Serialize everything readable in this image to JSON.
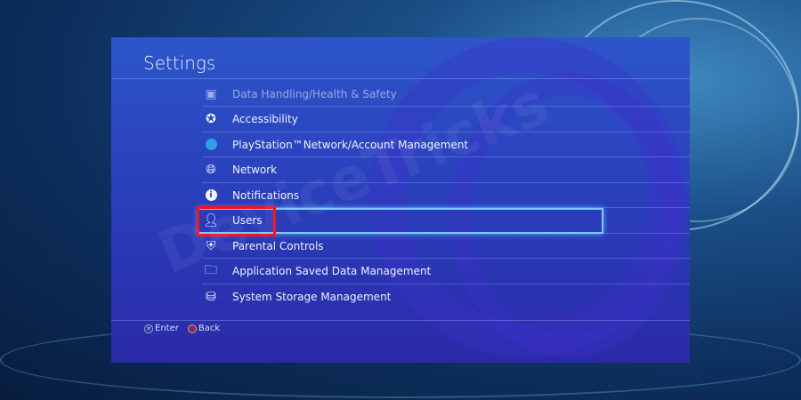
{
  "watermark": "DeviceTricks",
  "header": {
    "title": "Settings"
  },
  "menu": [
    {
      "label": "Data Handling/Health & Safety",
      "icon": "health-safety-icon"
    },
    {
      "label": "Accessibility",
      "icon": "accessibility-icon"
    },
    {
      "label": "PlayStation™Network/Account Management",
      "icon": "playstation-network-icon"
    },
    {
      "label": "Network",
      "icon": "globe-icon"
    },
    {
      "label": "Notifications",
      "icon": "info-icon"
    },
    {
      "label": "Users",
      "icon": "user-icon"
    },
    {
      "label": "Parental Controls",
      "icon": "parental-controls-icon"
    },
    {
      "label": "Application Saved Data Management",
      "icon": "folder-controller-icon"
    },
    {
      "label": "System Storage Management",
      "icon": "storage-icon"
    }
  ],
  "selected_index": 5,
  "footer": {
    "enter": "Enter",
    "back": "Back"
  },
  "colors": {
    "highlight": "#7fc6ff",
    "annotation": "#ff1010"
  }
}
